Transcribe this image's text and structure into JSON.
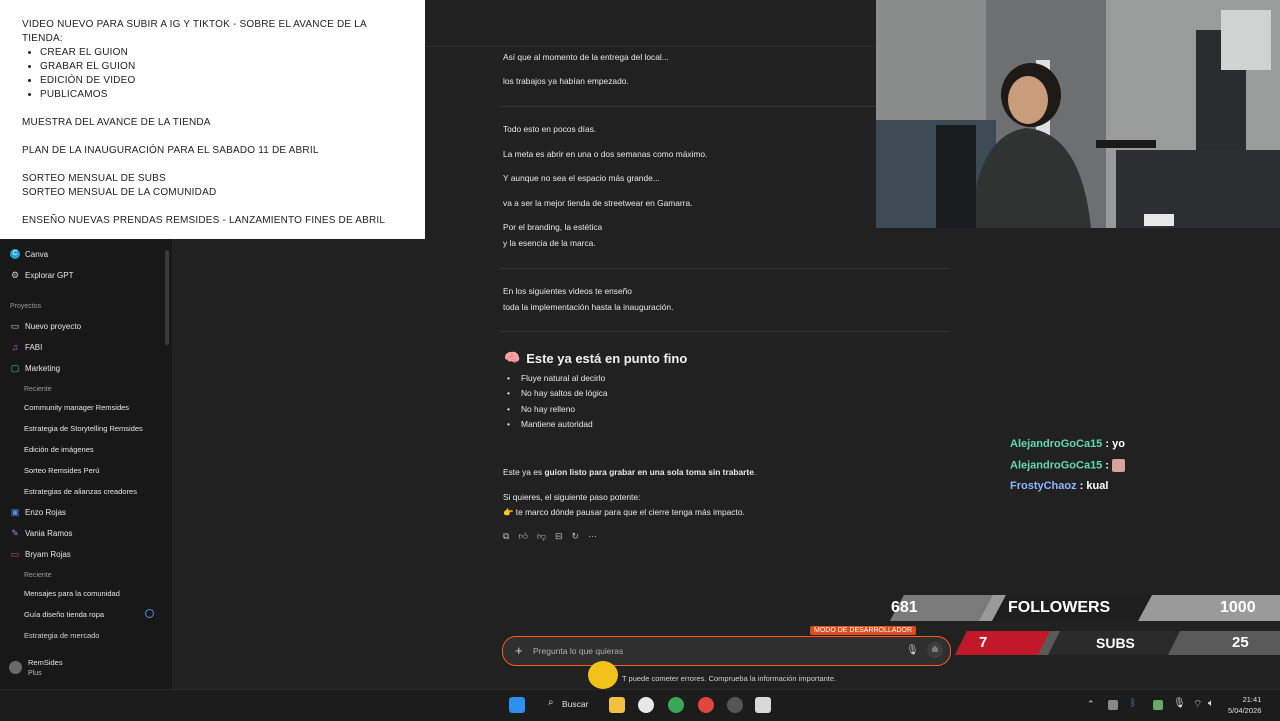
{
  "notes": {
    "title": "VIDEO NUEVO PARA SUBIR A IG Y TIKTOK - SOBRE EL AVANCE DE LA TIENDA:",
    "steps": [
      "CREAR EL GUION",
      "GRABAR EL GUION",
      "EDICIÓN DE VIDEO",
      "PUBLICAMOS"
    ],
    "item1": "MUESTRA DEL AVANCE DE LA TIENDA",
    "item2": "PLAN DE LA INAUGURACIÓN PARA EL SABADO 11 DE ABRIL",
    "item3a": "SORTEO MENSUAL DE SUBS",
    "item3b": "SORTEO MENSUAL DE LA COMUNIDAD",
    "item4": "ENSEÑO NUEVAS PRENDAS REMSIDES - LANZAMIENTO FINES DE ABRIL"
  },
  "sidebar": {
    "canva": "Canva",
    "explore_gpt": "Explorar GPT",
    "projects_label": "Proyectos",
    "new_project": "Nuevo proyecto",
    "fabi": "FABI",
    "marketing": "Marketing",
    "recent1": "Reciente",
    "marketing_chats": [
      "Community manager Remsides",
      "Estrategia de Storytelling Remsides",
      "Edición de imágenes",
      "Sorteo Remsides Perú",
      "Estrategias de alianzas creadores"
    ],
    "enzo": "Enzo Rojas",
    "vania": "Vania Ramos",
    "bryam": "Bryam Rojas",
    "recent2": "Reciente",
    "bryam_chats": [
      "Mensajes para la comunidad",
      "Guía diseño tienda ropa",
      "Estrategia de mercado"
    ],
    "user_name": "RemSides",
    "user_plan": "Plus"
  },
  "chat": {
    "l1": "Así que al momento de la entrega del local...",
    "l2": "los trabajos ya habían empezado.",
    "l3": "Todo esto en pocos días.",
    "l4": "La meta es abrir en una o dos semanas como máximo.",
    "l5": "Y aunque no sea el espacio más grande...",
    "l6": "va a ser la mejor tienda de streetwear en Gamarra.",
    "l7": "Por el branding, la estética",
    "l8": "y la esencia de la marca.",
    "l9": "En los siguientes videos te enseño",
    "l10": "toda la implementación hasta la inauguración.",
    "heading_emoji": "🧠",
    "heading": "Este ya está en punto fino",
    "bullets": [
      "Fluye natural al decirlo",
      "No hay saltos de lógica",
      "No hay relleno",
      "Mantiene autoridad"
    ],
    "l11a": "Este ya es ",
    "l11b": "guion listo para grabar en una sola toma sin trabarte",
    "l11c": ".",
    "l12": "Si quieres, el siguiente paso potente:",
    "l13_emoji": "👉",
    "l13": "te marco dónde pausar para que el cierre tenga más impacto."
  },
  "input": {
    "placeholder": "Pregunta lo que quieras",
    "dev_badge": "MODO DE DESARROLLADOR",
    "disclaimer": "T puede cometer errores. Comprueba la información importante."
  },
  "stream_chat": [
    {
      "user": "AlejandroGoCa15",
      "text": " : yo"
    },
    {
      "user": "AlejandroGoCa15",
      "text": " : "
    },
    {
      "user": "FrostyChaoz",
      "text": " : kual"
    }
  ],
  "followers": {
    "current": "681",
    "label": "FOLLOWERS",
    "goal": "1000"
  },
  "subs": {
    "current": "7",
    "label": "SUBS",
    "goal": "25"
  },
  "taskbar": {
    "search": "Buscar",
    "time": "21:41",
    "date": "5/04/2026"
  }
}
